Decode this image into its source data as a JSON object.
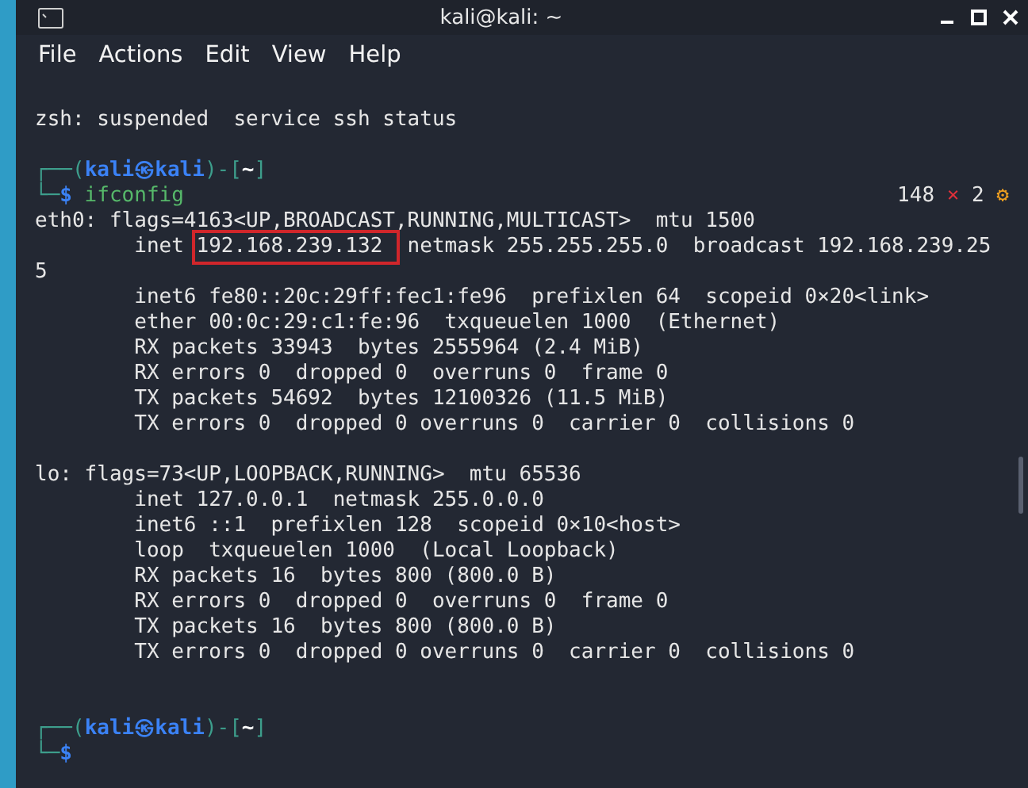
{
  "window": {
    "title": "kali@kali: ~"
  },
  "menu": [
    "File",
    "Actions",
    "Edit",
    "View",
    "Help"
  ],
  "lines": [
    {
      "kind": "output",
      "text": "zsh: suspended  service ssh status"
    },
    {
      "kind": "blank"
    },
    {
      "kind": "prompt",
      "segments": [
        {
          "text": "┌──(",
          "color": "#3d9e8c"
        },
        {
          "text": "kali㉿kali",
          "color": "#3b82f6"
        },
        {
          "text": ")-[",
          "color": "#3d9e8c"
        },
        {
          "text": "~",
          "color": "#ffffff"
        },
        {
          "text": "]",
          "color": "#3d9e8c"
        }
      ]
    },
    {
      "kind": "command",
      "segments": [
        {
          "text": "└─",
          "color": "#3d9e8c"
        },
        {
          "text": "$",
          "color": "#3b82f6"
        },
        {
          "text": " ifconfig",
          "color": "#56b86a"
        }
      ],
      "status": {
        "count": "148",
        "mark": "×",
        "code": "2",
        "icon": "⚙"
      }
    },
    {
      "kind": "output",
      "text": "eth0: flags=4163<UP,BROADCAST,RUNNING,MULTICAST>  mtu 1500"
    },
    {
      "kind": "highlighted",
      "before": "        inet ",
      "highlight": "192.168.239.132 ",
      "after": " netmask 255.255.255.0  broadcast 192.168.239.25"
    },
    {
      "kind": "output",
      "text": "5"
    },
    {
      "kind": "output",
      "text": "        inet6 fe80::20c:29ff:fec1:fe96  prefixlen 64  scopeid 0×20<link>"
    },
    {
      "kind": "output",
      "text": "        ether 00:0c:29:c1:fe:96  txqueuelen 1000  (Ethernet)"
    },
    {
      "kind": "output",
      "text": "        RX packets 33943  bytes 2555964 (2.4 MiB)"
    },
    {
      "kind": "output",
      "text": "        RX errors 0  dropped 0  overruns 0  frame 0"
    },
    {
      "kind": "output",
      "text": "        TX packets 54692  bytes 12100326 (11.5 MiB)"
    },
    {
      "kind": "output",
      "text": "        TX errors 0  dropped 0 overruns 0  carrier 0  collisions 0"
    },
    {
      "kind": "blank"
    },
    {
      "kind": "output",
      "text": "lo: flags=73<UP,LOOPBACK,RUNNING>  mtu 65536"
    },
    {
      "kind": "output",
      "text": "        inet 127.0.0.1  netmask 255.0.0.0"
    },
    {
      "kind": "output",
      "text": "        inet6 ::1  prefixlen 128  scopeid 0×10<host>"
    },
    {
      "kind": "output",
      "text": "        loop  txqueuelen 1000  (Local Loopback)"
    },
    {
      "kind": "output",
      "text": "        RX packets 16  bytes 800 (800.0 B)"
    },
    {
      "kind": "output",
      "text": "        RX errors 0  dropped 0  overruns 0  frame 0"
    },
    {
      "kind": "output",
      "text": "        TX packets 16  bytes 800 (800.0 B)"
    },
    {
      "kind": "output",
      "text": "        TX errors 0  dropped 0 overruns 0  carrier 0  collisions 0"
    },
    {
      "kind": "blank"
    },
    {
      "kind": "blank"
    },
    {
      "kind": "prompt",
      "segments": [
        {
          "text": "┌──(",
          "color": "#3d9e8c"
        },
        {
          "text": "kali㉿kali",
          "color": "#3b82f6"
        },
        {
          "text": ")-[",
          "color": "#3d9e8c"
        },
        {
          "text": "~",
          "color": "#ffffff"
        },
        {
          "text": "]",
          "color": "#3d9e8c"
        }
      ]
    },
    {
      "kind": "command",
      "segments": [
        {
          "text": "└─",
          "color": "#3d9e8c"
        },
        {
          "text": "$",
          "color": "#3b82f6"
        }
      ]
    }
  ]
}
